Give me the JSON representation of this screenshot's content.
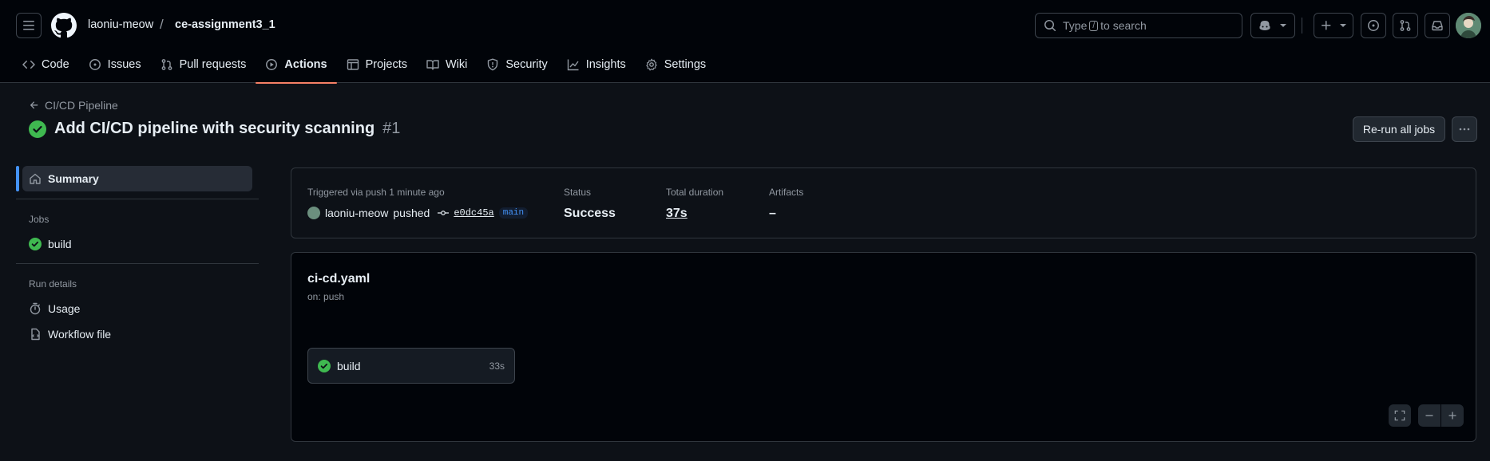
{
  "header": {
    "owner": "laoniu-meow",
    "separator": "/",
    "repo": "ce-assignment3_1",
    "search_prefix": "Type",
    "search_key": "/",
    "search_suffix": "to search"
  },
  "tabs": [
    {
      "label": "Code",
      "icon": "code-icon"
    },
    {
      "label": "Issues",
      "icon": "issue-icon"
    },
    {
      "label": "Pull requests",
      "icon": "pull-request-icon"
    },
    {
      "label": "Actions",
      "icon": "play-icon",
      "active": true
    },
    {
      "label": "Projects",
      "icon": "table-icon"
    },
    {
      "label": "Wiki",
      "icon": "book-icon"
    },
    {
      "label": "Security",
      "icon": "shield-icon"
    },
    {
      "label": "Insights",
      "icon": "graph-icon"
    },
    {
      "label": "Settings",
      "icon": "gear-icon"
    }
  ],
  "run": {
    "workflow_link": "CI/CD Pipeline",
    "title": "Add CI/CD pipeline with security scanning",
    "number": "#1",
    "rerun_label": "Re-run all jobs",
    "status_color": "#3fb950"
  },
  "sidebar": {
    "summary": "Summary",
    "jobs_heading": "Jobs",
    "job": "build",
    "run_details_heading": "Run details",
    "usage": "Usage",
    "workflow_file": "Workflow file"
  },
  "summary": {
    "trigger_label": "Triggered via push 1 minute ago",
    "actor": "laoniu-meow",
    "action": "pushed",
    "sha": "e0dc45a",
    "branch": "main",
    "status_label": "Status",
    "status_value": "Success",
    "duration_label": "Total duration",
    "duration_value": "37s",
    "artifacts_label": "Artifacts",
    "artifacts_value": "–"
  },
  "graph": {
    "file": "ci-cd.yaml",
    "trigger": "on: push",
    "job_name": "build",
    "job_duration": "33s"
  }
}
